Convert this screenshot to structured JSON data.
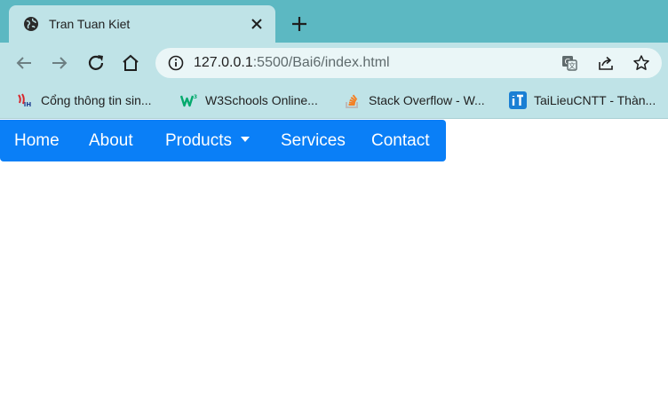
{
  "browser": {
    "tab": {
      "title": "Tran Tuan Kiet",
      "favicon": "globe-icon"
    },
    "address": {
      "host": "127.0.0.1",
      "path": ":5500/Bai6/index.html"
    },
    "bookmarks": [
      {
        "label": "Cổng thông tin sin...",
        "icon": "ih-logo-icon"
      },
      {
        "label": "W3Schools Online...",
        "icon": "w3schools-icon"
      },
      {
        "label": "Stack Overflow - W...",
        "icon": "stackoverflow-icon"
      },
      {
        "label": "TaiLieuCNTT - Thàn...",
        "icon": "tailieucntt-icon"
      }
    ],
    "colors": {
      "frame": "#5cb8c2",
      "toolbar": "#bfe3e7",
      "omnibox": "#eaf6f7"
    }
  },
  "navbar": {
    "color": "#0a7ff7",
    "links": [
      "Home",
      "About",
      "Products",
      "Services",
      "Contact"
    ]
  }
}
